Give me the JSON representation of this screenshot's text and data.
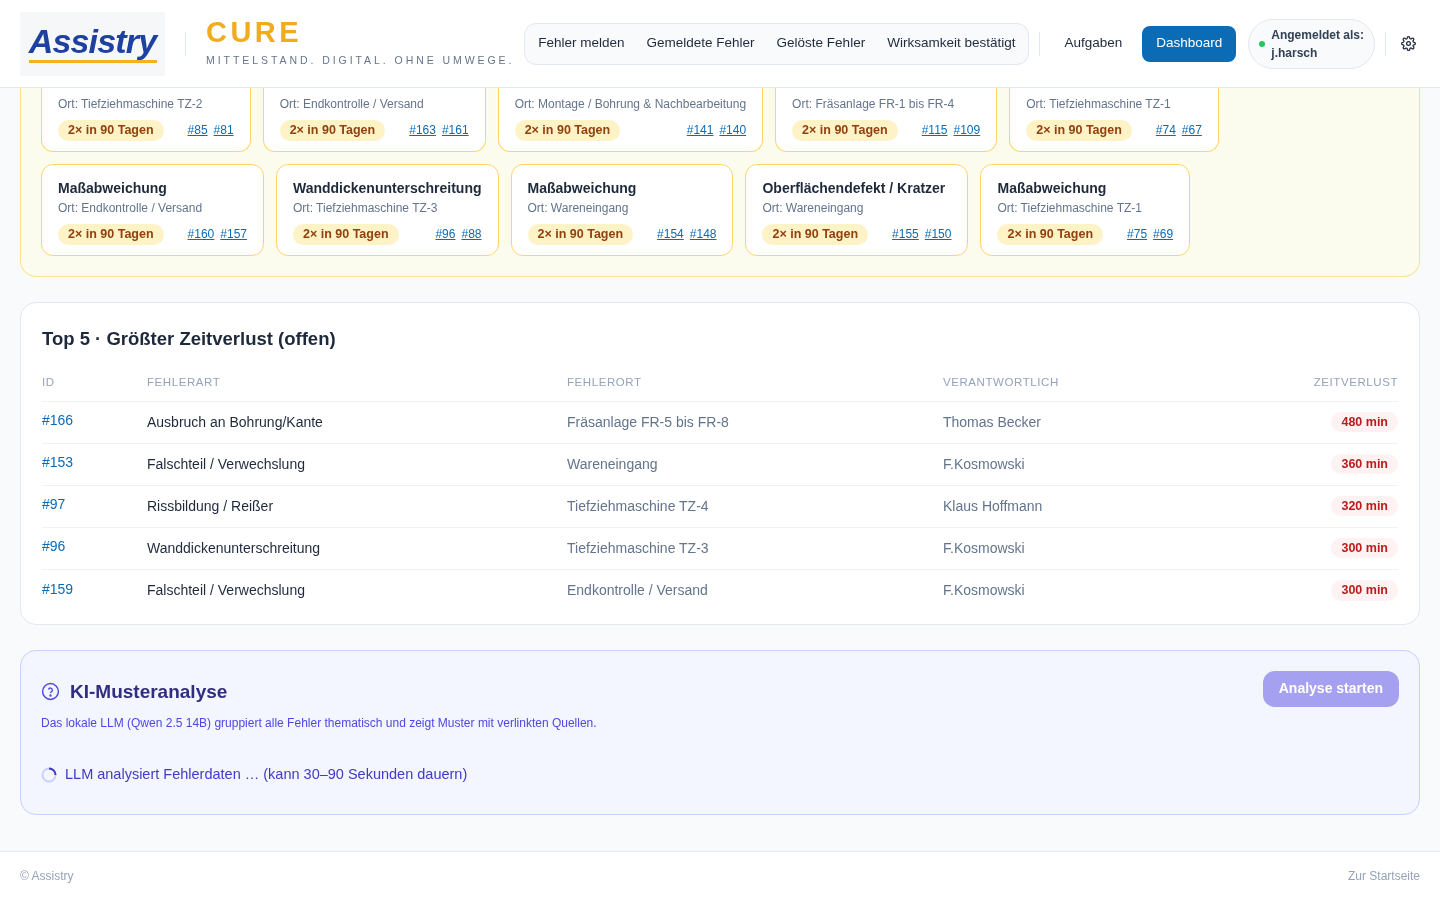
{
  "header": {
    "logo_text": "Assistry",
    "brand": "CURE",
    "tagline": "MITTELSTAND. DIGITAL. OHNE UMWEGE.",
    "nav_group": [
      {
        "label": "Fehler melden",
        "selected": false
      },
      {
        "label": "Gemeldete Fehler",
        "selected": false
      },
      {
        "label": "Gelöste Fehler",
        "selected": false
      },
      {
        "label": "Wirksamkeit bestätigt",
        "selected": false
      }
    ],
    "nav_links": [
      {
        "label": "Aufgaben",
        "selected": false
      },
      {
        "label": "Dashboard",
        "selected": true
      }
    ],
    "user": {
      "label": "Angemeldet als:",
      "name": "j.harsch",
      "online": true
    }
  },
  "clusters": {
    "rows": [
      [
        {
          "location": "Ort: Tiefziehmaschine TZ-2",
          "badge": "2× in 90 Tagen",
          "refs": [
            "#85",
            "#81"
          ]
        },
        {
          "location": "Ort: Endkontrolle / Versand",
          "badge": "2× in 90 Tagen",
          "refs": [
            "#163",
            "#161"
          ]
        },
        {
          "location": "Ort: Montage / Bohrung & Nachbearbeitung",
          "badge": "2× in 90 Tagen",
          "refs": [
            "#141",
            "#140"
          ]
        },
        {
          "location": "Ort: Fräsanlage FR-1 bis FR-4",
          "badge": "2× in 90 Tagen",
          "refs": [
            "#115",
            "#109"
          ]
        },
        {
          "location": "Ort: Tiefziehmaschine TZ-1",
          "badge": "2× in 90 Tagen",
          "refs": [
            "#74",
            "#67"
          ]
        }
      ],
      [
        {
          "title": "Maßabweichung",
          "location": "Ort: Endkontrolle / Versand",
          "badge": "2× in 90 Tagen",
          "refs": [
            "#160",
            "#157"
          ]
        },
        {
          "title": "Wanddickenunterschreitung",
          "location": "Ort: Tiefziehmaschine TZ-3",
          "badge": "2× in 90 Tagen",
          "refs": [
            "#96",
            "#88"
          ]
        },
        {
          "title": "Maßabweichung",
          "location": "Ort: Wareneingang",
          "badge": "2× in 90 Tagen",
          "refs": [
            "#154",
            "#148"
          ]
        },
        {
          "title": "Oberflächendefekt / Kratzer",
          "location": "Ort: Wareneingang",
          "badge": "2× in 90 Tagen",
          "refs": [
            "#155",
            "#150"
          ]
        },
        {
          "title": "Maßabweichung",
          "location": "Ort: Tiefziehmaschine TZ-1",
          "badge": "2× in 90 Tagen",
          "refs": [
            "#75",
            "#69"
          ]
        }
      ]
    ]
  },
  "top5": {
    "title": "Top 5 · Größter Zeitverlust (offen)",
    "columns": [
      "ID",
      "FEHLERART",
      "FEHLERORT",
      "VERANTWORTLICH",
      "ZEITVERLUST"
    ],
    "rows": [
      {
        "id": "#166",
        "type": "Ausbruch an Bohrung/Kante",
        "location": "Fräsanlage FR-5 bis FR-8",
        "owner": "Thomas Becker",
        "loss": "480 min"
      },
      {
        "id": "#153",
        "type": "Falschteil / Verwechslung",
        "location": "Wareneingang",
        "owner": "F.Kosmowski",
        "loss": "360 min"
      },
      {
        "id": "#97",
        "type": "Rissbildung / Reißer",
        "location": "Tiefziehmaschine TZ-4",
        "owner": "Klaus Hoffmann",
        "loss": "320 min"
      },
      {
        "id": "#96",
        "type": "Wanddickenunterschreitung",
        "location": "Tiefziehmaschine TZ-3",
        "owner": "F.Kosmowski",
        "loss": "300 min"
      },
      {
        "id": "#159",
        "type": "Falschteil / Verwechslung",
        "location": "Endkontrolle / Versand",
        "owner": "F.Kosmowski",
        "loss": "300 min"
      }
    ]
  },
  "ai": {
    "title": "KI-Musteranalyse",
    "description": "Das lokale LLM (Qwen 2.5 14B) gruppiert alle Fehler thematisch und zeigt Muster mit verlinkten Quellen.",
    "button": {
      "label": "Analyse starten",
      "disabled": true
    },
    "status": {
      "text": "LLM analysiert Fehlerdaten … (kann 30–90 Sekunden dauern)",
      "loading": true
    }
  },
  "footer": {
    "left": "© Assistry",
    "right": "Zur Startseite"
  }
}
